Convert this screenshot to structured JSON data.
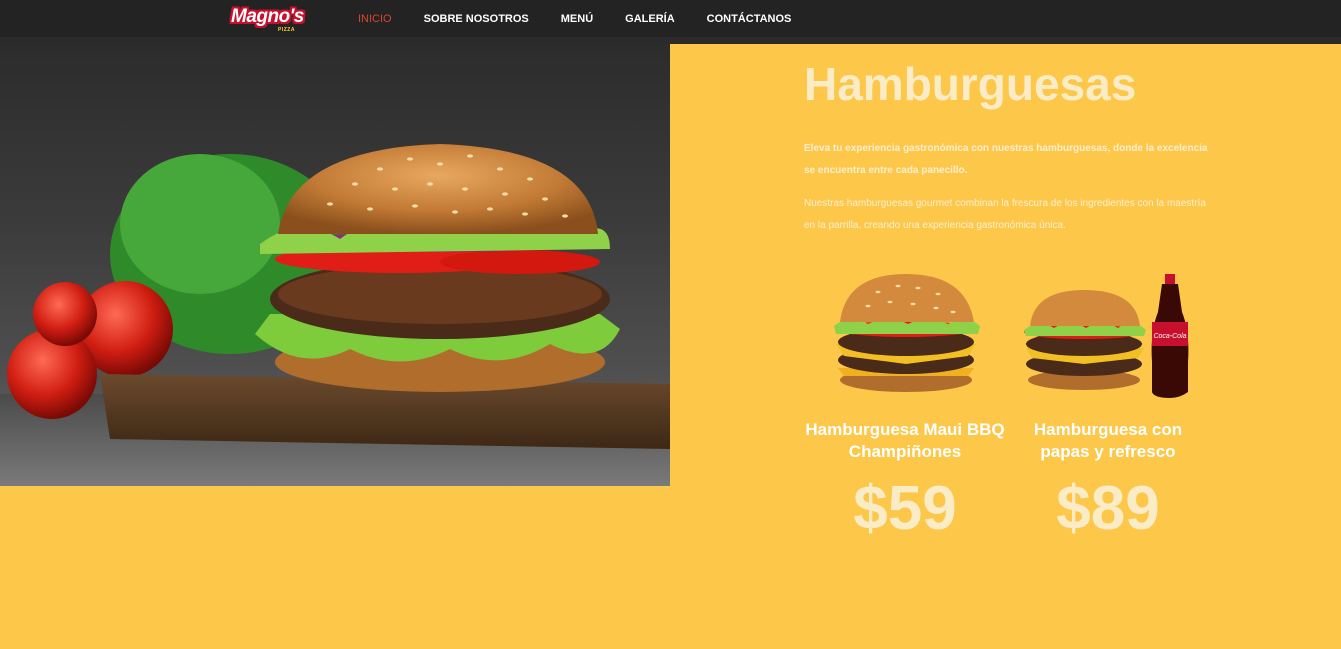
{
  "brand": {
    "logo_text": "Magno's",
    "logo_sub": "PIZZA"
  },
  "nav": {
    "items": [
      {
        "label": "INICIO",
        "active": true
      },
      {
        "label": "SOBRE NOSOTROS",
        "active": false
      },
      {
        "label": "MENÚ",
        "active": false
      },
      {
        "label": "GALERÍA",
        "active": false
      },
      {
        "label": "CONTÁCTANOS",
        "active": false
      }
    ]
  },
  "section": {
    "title": "Hamburguesas",
    "paragraph1": "Eleva tu experiencia gastronómica con nuestras hamburguesas, donde la excelencia se encuentra entre cada panecillo.",
    "paragraph2": "Nuestras hamburguesas gourmet combinan la frescura de los ingredientes con la maestría en la parrilla, creando una experiencia gastronómica única."
  },
  "products": [
    {
      "name": "Hamburguesa Maui BBQ Champiñones",
      "price": "$59"
    },
    {
      "name": "Hamburguesa con papas y refresco",
      "price": "$89"
    }
  ],
  "colors": {
    "background": "#fdc74a",
    "nav_bg": "#232323",
    "nav_active": "#d9452c",
    "title": "#fbecc8"
  }
}
